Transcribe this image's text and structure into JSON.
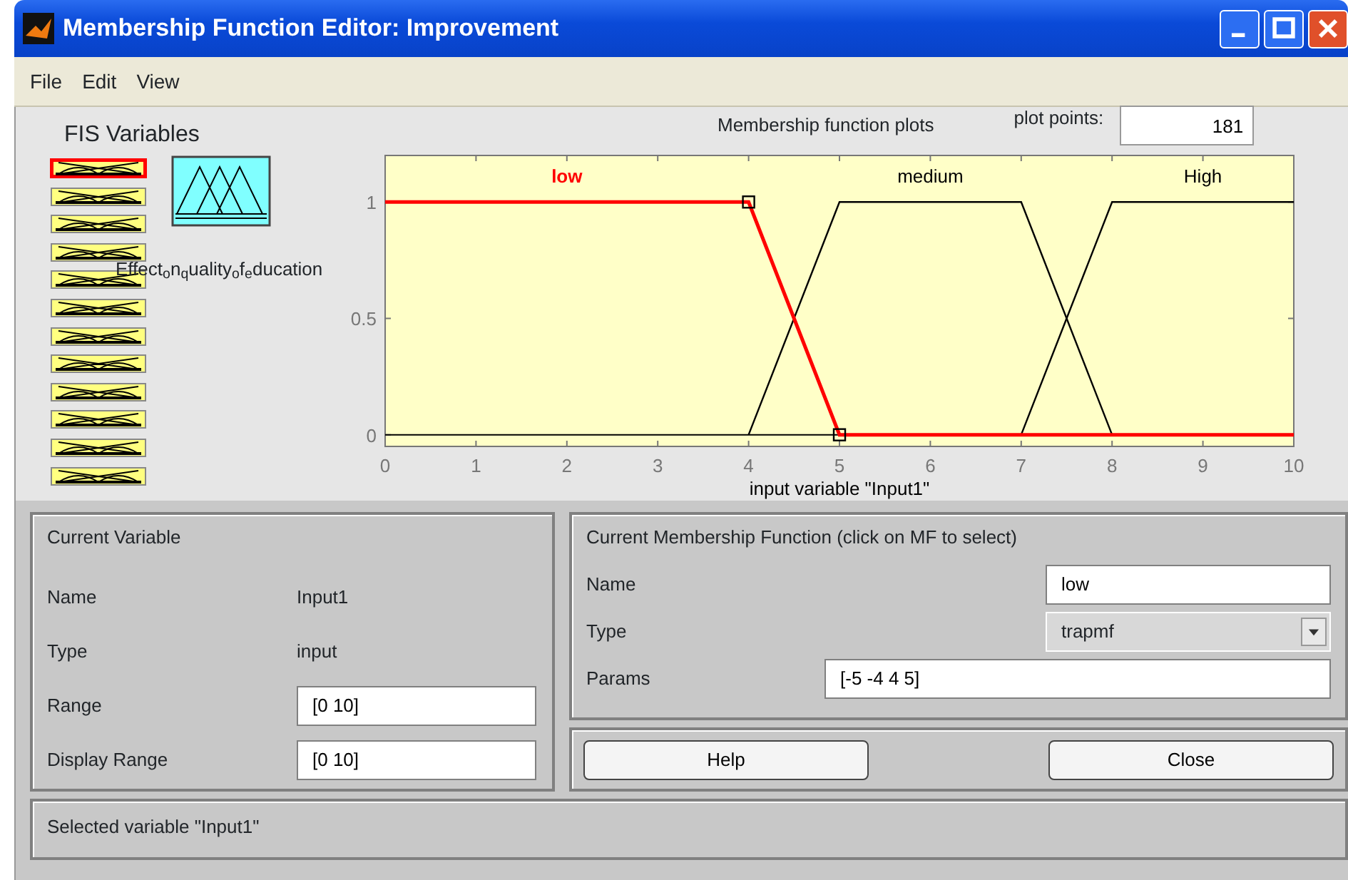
{
  "window": {
    "title": "Membership Function Editor: Improvement"
  },
  "menu": [
    "File",
    "Edit",
    "View"
  ],
  "fis_variables": {
    "title": "FIS Variables",
    "items": [
      {
        "kind": "input",
        "selected": true
      },
      {
        "kind": "input",
        "selected": false
      },
      {
        "kind": "input",
        "selected": false
      },
      {
        "kind": "input",
        "selected": false
      },
      {
        "kind": "input",
        "selected": false
      },
      {
        "kind": "input",
        "selected": false
      },
      {
        "kind": "input",
        "selected": false
      },
      {
        "kind": "input",
        "selected": false
      },
      {
        "kind": "input",
        "selected": false
      },
      {
        "kind": "input",
        "selected": false
      },
      {
        "kind": "input",
        "selected": false
      },
      {
        "kind": "input",
        "selected": false
      },
      {
        "kind": "output",
        "selected": false,
        "label": "Effect$_{o}$n$_{q}$uality$_{o}$f$_{e}$ducation"
      }
    ]
  },
  "plot": {
    "title": "Membership function plots",
    "plot_points_label": "plot points:",
    "plot_points": "181",
    "membership_functions": [
      {
        "selected": true
      },
      {
        "selected": false
      },
      {
        "selected": false
      }
    ],
    "chart_data": {
      "type": "line",
      "xlabel": "input variable \"Input1\"",
      "x": [
        0,
        4,
        5,
        7,
        8,
        10
      ],
      "series": [
        {
          "name": "low",
          "color": "#ff0000",
          "values": [
            1,
            1,
            0,
            0,
            0,
            0
          ]
        },
        {
          "name": "medium",
          "color": "#000000",
          "values": [
            null,
            0,
            1,
            1,
            0,
            null
          ]
        },
        {
          "name": "High",
          "color": "#000000",
          "values": [
            null,
            null,
            null,
            0,
            1,
            1
          ]
        }
      ],
      "xlim": [
        0,
        10
      ],
      "ylim": [
        -0.05,
        1.2
      ],
      "xticks": [
        0,
        1,
        2,
        3,
        4,
        5,
        6,
        7,
        8,
        9,
        10
      ],
      "yticks": [
        0,
        0.5,
        1
      ]
    }
  },
  "current_variable": {
    "title": "Current Variable",
    "fields": [
      {
        "label": "Name",
        "value": "Input1",
        "kind": "text"
      },
      {
        "label": "Type",
        "value": "input",
        "kind": "text"
      },
      {
        "label": "Range",
        "value": "[0 10]",
        "kind": "input"
      },
      {
        "label": "Display Range",
        "value": "[0 10]",
        "kind": "input"
      }
    ]
  },
  "current_mf": {
    "title": "Current Membership Function (click on MF to select)",
    "fields": [
      {
        "label": "Name",
        "value": "low",
        "kind": "input"
      },
      {
        "label": "Type",
        "value": "trapmf",
        "kind": "select"
      },
      {
        "label": "Params",
        "value": "[-5 -4 4 5]",
        "kind": "input"
      }
    ]
  },
  "buttons": [
    "Help",
    "Close"
  ],
  "status_bar": "Selected variable \"Input1\""
}
